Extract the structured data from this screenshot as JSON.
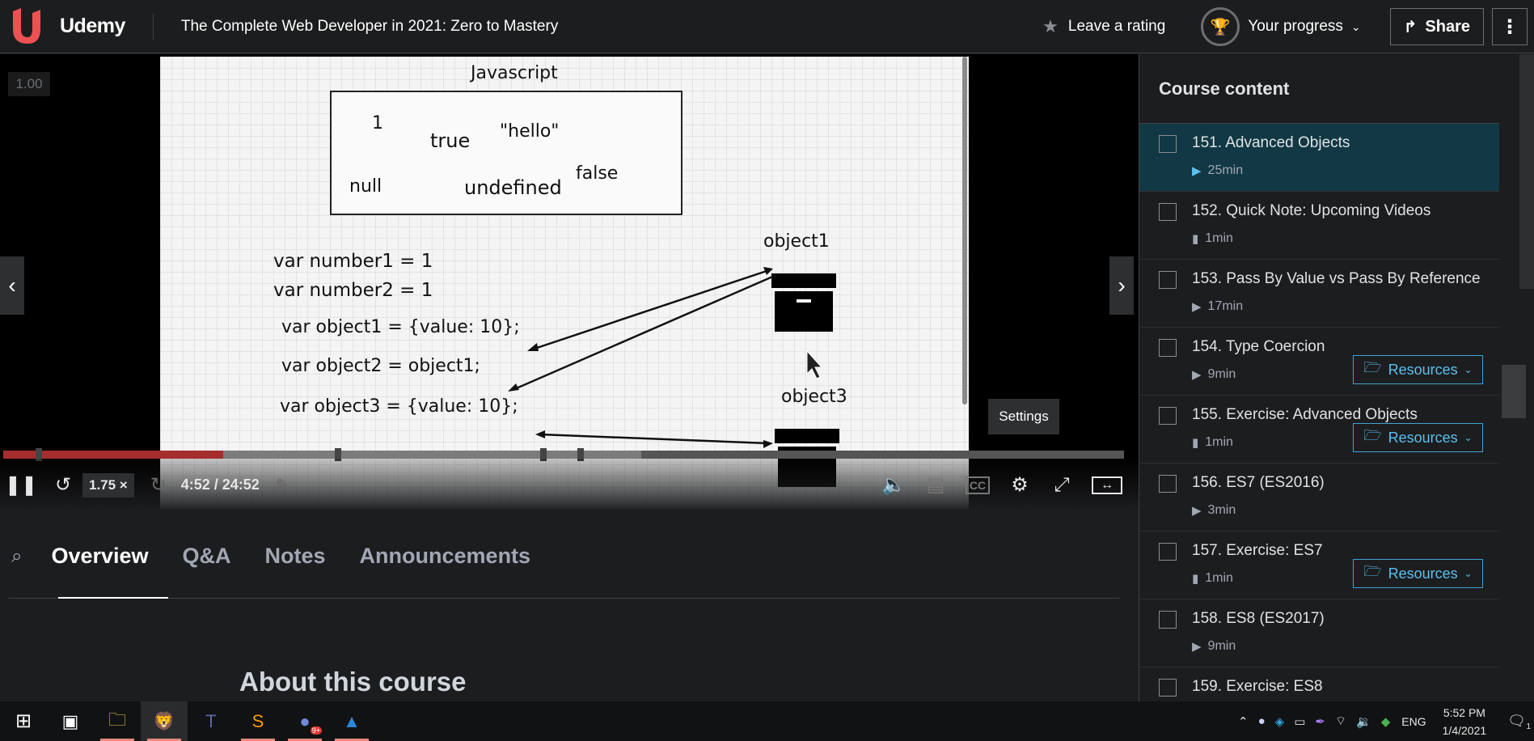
{
  "app": {
    "brand": "Udemy",
    "course_title": "The Complete Web Developer in 2021: Zero to Mastery",
    "rating_label": "Leave a rating",
    "progress_label": "Your progress",
    "share_label": "Share"
  },
  "player": {
    "rate_badge": "1.00",
    "speed": "1.75 ×",
    "time": "4:52 / 24:52",
    "played_fraction": 0.196,
    "buffered_fraction": 0.569,
    "settings_tooltip": "Settings"
  },
  "slide": {
    "heading": "Javascript",
    "box_values": [
      "1",
      "true",
      "\"hello\"",
      "false",
      "null",
      "undefined"
    ],
    "code_lines": [
      "var number1 = 1",
      "var number2 = 1",
      "var object1 = {value: 10};",
      "var object2 = object1;",
      "var object3 = {value: 10};"
    ],
    "object1_label": "object1",
    "object3_label": "object3"
  },
  "tabs": [
    {
      "label": "Overview",
      "active": true
    },
    {
      "label": "Q&A",
      "active": false
    },
    {
      "label": "Notes",
      "active": false
    },
    {
      "label": "Announcements",
      "active": false
    }
  ],
  "about_heading": "About this course",
  "sidebar": {
    "title": "Course content",
    "items": [
      {
        "label": "151. Advanced Objects",
        "duration": "25min",
        "type": "video",
        "current": true,
        "resources": false
      },
      {
        "label": "152. Quick Note: Upcoming Videos",
        "duration": "1min",
        "type": "doc",
        "current": false,
        "resources": false
      },
      {
        "label": "153. Pass By Value vs Pass By Reference",
        "duration": "17min",
        "type": "video",
        "current": false,
        "resources": false
      },
      {
        "label": "154. Type Coercion",
        "duration": "9min",
        "type": "video",
        "current": false,
        "resources": true
      },
      {
        "label": "155. Exercise: Advanced Objects",
        "duration": "1min",
        "type": "doc",
        "current": false,
        "resources": true
      },
      {
        "label": "156. ES7 (ES2016)",
        "duration": "3min",
        "type": "video",
        "current": false,
        "resources": false
      },
      {
        "label": "157. Exercise: ES7",
        "duration": "1min",
        "type": "doc",
        "current": false,
        "resources": true
      },
      {
        "label": "158. ES8 (ES2017)",
        "duration": "9min",
        "type": "video",
        "current": false,
        "resources": false
      },
      {
        "label": "159. Exercise: ES8",
        "duration": "",
        "type": "doc",
        "current": false,
        "resources": false
      }
    ],
    "resources_label": "Resources"
  },
  "taskbar": {
    "time": "5:52 PM",
    "date": "1/4/2021",
    "lang": "ENG",
    "badge": "9+",
    "notif_count": "1"
  },
  "colors": {
    "accent_red": "#a52d2d",
    "link_blue": "#5cc0ee",
    "current_row": "#113844",
    "brand": "#ec5252"
  }
}
